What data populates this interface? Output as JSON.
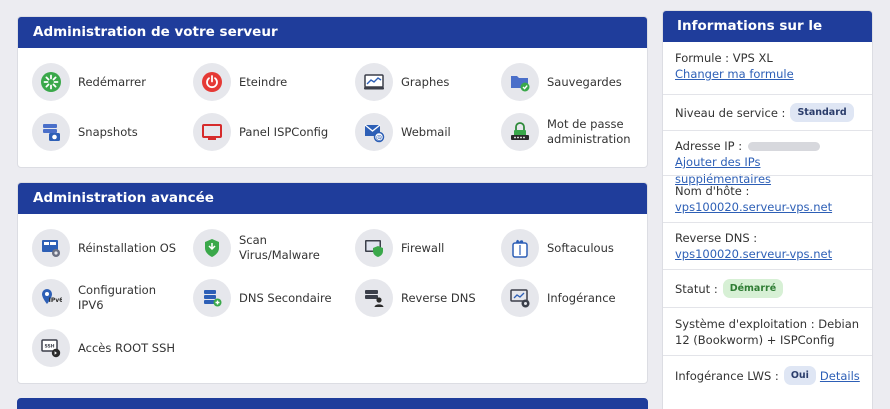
{
  "server_admin": {
    "title": "Administration de votre serveur",
    "items": [
      {
        "label": "Redémarrer",
        "icon": "restart-icon"
      },
      {
        "label": "Eteindre",
        "icon": "power-icon"
      },
      {
        "label": "Graphes",
        "icon": "graph-icon"
      },
      {
        "label": "Sauvegardes",
        "icon": "backup-folder-icon"
      },
      {
        "label": "Snapshots",
        "icon": "snapshot-icon"
      },
      {
        "label": "Panel ISPConfig",
        "icon": "panel-icon"
      },
      {
        "label": "Webmail",
        "icon": "webmail-icon"
      },
      {
        "label": "Mot de passe administration",
        "icon": "password-icon"
      }
    ]
  },
  "advanced_admin": {
    "title": "Administration avancée",
    "items": [
      {
        "label": "Réinstallation OS",
        "icon": "reinstall-icon"
      },
      {
        "label": "Scan Virus/Malware",
        "icon": "shield-scan-icon"
      },
      {
        "label": "Firewall",
        "icon": "firewall-icon"
      },
      {
        "label": "Softaculous",
        "icon": "softaculous-icon"
      },
      {
        "label": "Configuration IPV6",
        "icon": "ipv6-pin-icon"
      },
      {
        "label": "DNS Secondaire",
        "icon": "dns-icon"
      },
      {
        "label": "Reverse DNS",
        "icon": "reverse-dns-icon"
      },
      {
        "label": "Infogérance",
        "icon": "managed-icon"
      },
      {
        "label": "Accès ROOT SSH",
        "icon": "ssh-icon"
      }
    ]
  },
  "account": {
    "title": "Informations sur le compte",
    "formula_label": "Formule :",
    "formula_value": "VPS XL",
    "change_formula": "Changer ma formule",
    "service_label": "Niveau de service :",
    "service_badge": "Standard",
    "ip_label": "Adresse IP :",
    "add_ips": "Ajouter des IPs supplémentaires",
    "hostname_label": "Nom d'hôte :",
    "hostname_value": "vps100020.serveur-vps.net",
    "rdns_label": "Reverse DNS :",
    "rdns_value": "vps100020.serveur-vps.net",
    "status_label": "Statut :",
    "status_badge": "Démarré",
    "os_label": "Système d'exploitation :",
    "os_value": "Debian 12 (Bookworm) + ISPConfig",
    "lws_label": "Infogérance LWS :",
    "lws_badge": "Oui",
    "lws_details": "Details"
  },
  "colors": {
    "header": "#1f3d9b",
    "link": "#2d5fb6",
    "background": "#ececf1"
  }
}
